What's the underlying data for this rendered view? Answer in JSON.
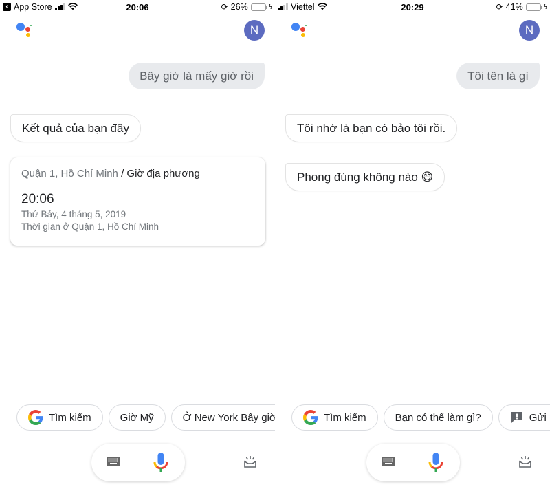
{
  "panels": [
    {
      "status_bar": {
        "back_app": "App Store",
        "carrier": "",
        "time": "20:06",
        "battery_percent": "26%",
        "battery_level": 0.26
      },
      "avatar_initial": "N",
      "user_query": "Bây giờ là mấy giờ rồi",
      "bot_messages": [
        "Kết quả của bạn đây"
      ],
      "card": {
        "location": "Quận 1, Hồ Chí Minh",
        "separator": " / ",
        "title": "Giờ địa phương",
        "time": "20:06",
        "date": "Thứ Bảy, 4 tháng 5, 2019",
        "caption": "Thời gian ở Quận 1, Hồ Chí Minh"
      },
      "chips": [
        {
          "label": "Tìm kiếm",
          "icon": "google-g-icon"
        },
        {
          "label": "Giờ Mỹ",
          "icon": null
        },
        {
          "label": "Ở New York Bây giờ là",
          "icon": null
        }
      ]
    },
    {
      "status_bar": {
        "back_app": "",
        "carrier": "Viettel",
        "time": "20:29",
        "battery_percent": "41%",
        "battery_level": 0.41
      },
      "avatar_initial": "N",
      "user_query": "Tôi tên là gì",
      "bot_messages": [
        "Tôi nhớ là bạn có bảo tôi rồi.",
        "Phong đúng không nào 😄"
      ],
      "chips": [
        {
          "label": "Tìm kiếm",
          "icon": "google-g-icon"
        },
        {
          "label": "Bạn có thể làm gì?",
          "icon": null
        },
        {
          "label": "Gửi phản hồi",
          "icon": "feedback-icon"
        }
      ]
    }
  ],
  "colors": {
    "assistant_blue": "#4285f4",
    "assistant_red": "#ea4335",
    "assistant_yellow": "#fbbc05",
    "assistant_green": "#34a853",
    "avatar_bg": "#5c6bc0",
    "user_bubble_bg": "#e8eaed",
    "battery_fill": "#f5c20c"
  }
}
